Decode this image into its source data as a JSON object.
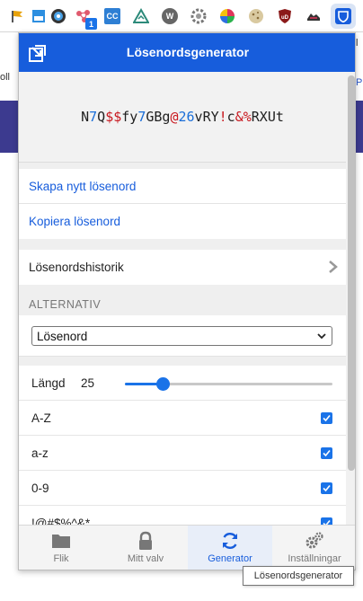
{
  "background": {
    "left_text": "oll",
    "right_text_1": "l",
    "right_text_2": "P"
  },
  "toolbar": {
    "extensions": [
      {
        "icon": "flag-icon",
        "color": "#e8a20a"
      },
      {
        "icon": "blue-window-icon",
        "color": "#2d8fe0"
      },
      {
        "icon": "circle-target-icon",
        "color": "#555555"
      },
      {
        "icon": "nodes-icon",
        "color": "#e05a6e"
      },
      {
        "icon": "cc-icon",
        "color": "#2e7fd4"
      },
      {
        "icon": "triangle-icon",
        "color": "#2c8a7a"
      },
      {
        "icon": "w-icon",
        "color": "#666666"
      },
      {
        "icon": "gear-extension-icon",
        "color": "#777777"
      },
      {
        "icon": "color-wheel-icon",
        "color": "#e0355b"
      },
      {
        "icon": "cookie-icon",
        "color": "#c9b98a"
      },
      {
        "icon": "ublock-icon",
        "color": "#8b1a1a"
      },
      {
        "icon": "sneaker-icon",
        "color": "#333333"
      },
      {
        "icon": "bitwarden-shield-icon",
        "color": "#175ddc"
      }
    ],
    "badge": "1",
    "cc_label": "CC",
    "w_label": "W",
    "ub_label": "uD"
  },
  "popup": {
    "title": "Lösenordsgenerator",
    "password_segments": [
      {
        "t": "N",
        "k": "l"
      },
      {
        "t": "7",
        "k": "d"
      },
      {
        "t": "Q",
        "k": "l"
      },
      {
        "t": "$$",
        "k": "s"
      },
      {
        "t": "fy",
        "k": "l"
      },
      {
        "t": "7",
        "k": "d"
      },
      {
        "t": "GBg",
        "k": "l"
      },
      {
        "t": "@",
        "k": "s"
      },
      {
        "t": "26",
        "k": "d"
      },
      {
        "t": "vRY",
        "k": "l"
      },
      {
        "t": "!",
        "k": "s"
      },
      {
        "t": "c",
        "k": "l"
      },
      {
        "t": "&%",
        "k": "s"
      },
      {
        "t": "RXUt",
        "k": "l"
      }
    ],
    "actions": {
      "regenerate": "Skapa nytt lösenord",
      "copy": "Kopiera lösenord"
    },
    "history_label": "Lösenordshistorik",
    "section_label": "ALTERNATIV",
    "type_select": {
      "value": "Lösenord"
    },
    "length": {
      "label": "Längd",
      "value": "25",
      "slider_fraction": 0.18
    },
    "options": [
      {
        "label": "A-Z",
        "checked": true
      },
      {
        "label": "a-z",
        "checked": true
      },
      {
        "label": "0-9",
        "checked": true
      },
      {
        "label": "!@#$%^&*",
        "checked": true
      }
    ]
  },
  "footer": {
    "tabs": [
      {
        "label": "Flik",
        "icon": "folder-icon",
        "active": false
      },
      {
        "label": "Mitt valv",
        "icon": "lock-icon",
        "active": false
      },
      {
        "label": "Generator",
        "icon": "refresh-icon",
        "active": true
      },
      {
        "label": "Inställningar",
        "icon": "gears-icon",
        "active": false
      }
    ]
  },
  "tooltip": "Lösenordsgenerator",
  "colors": {
    "brand": "#175ddc",
    "accent": "#1a73e8",
    "special_char": "#c8171e",
    "digit_char": "#1a6ed8"
  }
}
